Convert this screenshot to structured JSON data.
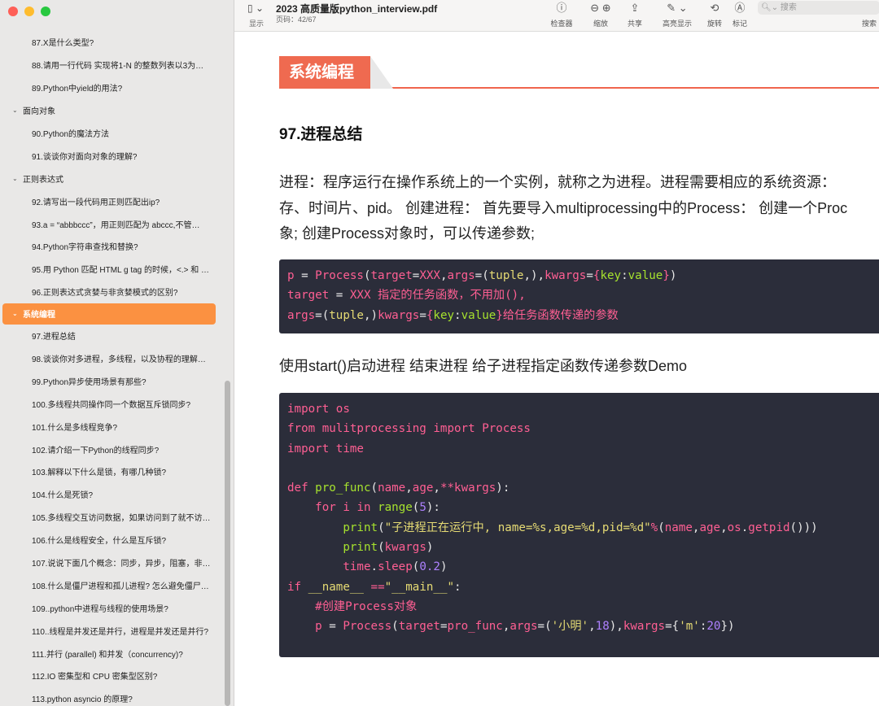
{
  "window": {
    "document_title": "2023 高质量版python_interview.pdf",
    "page_indicator": "页码：42/67"
  },
  "toolbar": {
    "view_label": "显示",
    "inspector_label": "检查器",
    "zoom_label": "缩放",
    "share_label": "共享",
    "highlight_label": "高亮显示",
    "rotate_label": "旋转",
    "markup_label": "标记",
    "search_placeholder": "搜索",
    "search_label": "搜索"
  },
  "sidebar": {
    "items": [
      {
        "type": "item",
        "label": "87.X是什么类型?"
      },
      {
        "type": "item",
        "label": "88.请用一行代码 实现将1-N 的整数列表以3为…"
      },
      {
        "type": "item",
        "label": "89.Python中yield的用法?"
      },
      {
        "type": "section",
        "label": "面向对象"
      },
      {
        "type": "item",
        "label": "90.Python的魔法方法"
      },
      {
        "type": "item",
        "label": "91.谈谈你对面向对象的理解?"
      },
      {
        "type": "section",
        "label": "正则表达式"
      },
      {
        "type": "item",
        "label": "92.请写出一段代码用正则匹配出ip?"
      },
      {
        "type": "item",
        "label": "93.a = “abbbccc”，用正则匹配为 abccc,不管…"
      },
      {
        "type": "item",
        "label": "94.Python字符串查找和替换?"
      },
      {
        "type": "item",
        "label": "95.用 Python 匹配 HTML g tag 的时候，<.> 和 <…"
      },
      {
        "type": "item",
        "label": "96.正则表达式贪婪与非贪婪模式的区别?"
      },
      {
        "type": "section",
        "label": "系统编程",
        "active": true
      },
      {
        "type": "item",
        "label": "97.进程总结"
      },
      {
        "type": "item",
        "label": "98.谈谈你对多进程，多线程，以及协程的理解…"
      },
      {
        "type": "item",
        "label": "99.Python异步使用场景有那些?"
      },
      {
        "type": "item",
        "label": "100.多线程共同操作同一个数据互斥锁同步?"
      },
      {
        "type": "item",
        "label": "101.什么是多线程竞争?"
      },
      {
        "type": "item",
        "label": "102.请介绍一下Python的线程同步?"
      },
      {
        "type": "item",
        "label": "103.解释以下什么是锁，有哪几种锁?"
      },
      {
        "type": "item",
        "label": "104.什么是死锁?"
      },
      {
        "type": "item",
        "label": "105.多线程交互访问数据，如果访问到了就不访…"
      },
      {
        "type": "item",
        "label": "106.什么是线程安全，什么是互斥锁?"
      },
      {
        "type": "item",
        "label": "107.说说下面几个概念：同步，异步，阻塞，非…"
      },
      {
        "type": "item",
        "label": "108.什么是僵尸进程和孤儿进程? 怎么避免僵尸…"
      },
      {
        "type": "item",
        "label": "109..python中进程与线程的使用场景?"
      },
      {
        "type": "item",
        "label": "110..线程是并发还是并行，进程是并发还是并行?"
      },
      {
        "type": "item",
        "label": "111.并行 (parallel) 和并发（concurrency)?"
      },
      {
        "type": "item",
        "label": "112.IO 密集型和 CPU 密集型区别?"
      },
      {
        "type": "item",
        "label": "113.python asyncio 的原理?"
      }
    ]
  },
  "document": {
    "banner": "系统编程",
    "heading": "97.进程总结",
    "para_lines": [
      "进程：程序运行在操作系统上的一个实例，就称之为进程。进程需要相应的系统资源：",
      "存、时间片、pid。 创建进程： 首先要导入multiprocessing中的Process： 创建一个Proc",
      "象; 创建Process对象时，可以传递参数;"
    ],
    "para2": "使用start()启动进程 结束进程 给子进程指定函数传递参数Demo"
  }
}
